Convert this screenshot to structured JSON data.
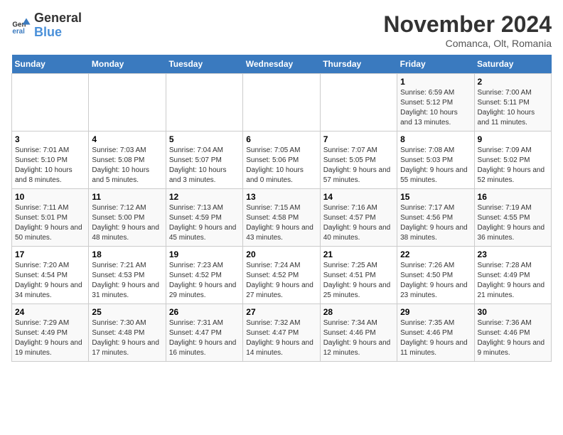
{
  "logo": {
    "line1": "General",
    "line2": "Blue"
  },
  "title": "November 2024",
  "subtitle": "Comanca, Olt, Romania",
  "days_of_week": [
    "Sunday",
    "Monday",
    "Tuesday",
    "Wednesday",
    "Thursday",
    "Friday",
    "Saturday"
  ],
  "weeks": [
    [
      {
        "day": "",
        "info": ""
      },
      {
        "day": "",
        "info": ""
      },
      {
        "day": "",
        "info": ""
      },
      {
        "day": "",
        "info": ""
      },
      {
        "day": "",
        "info": ""
      },
      {
        "day": "1",
        "info": "Sunrise: 6:59 AM\nSunset: 5:12 PM\nDaylight: 10 hours and 13 minutes."
      },
      {
        "day": "2",
        "info": "Sunrise: 7:00 AM\nSunset: 5:11 PM\nDaylight: 10 hours and 11 minutes."
      }
    ],
    [
      {
        "day": "3",
        "info": "Sunrise: 7:01 AM\nSunset: 5:10 PM\nDaylight: 10 hours and 8 minutes."
      },
      {
        "day": "4",
        "info": "Sunrise: 7:03 AM\nSunset: 5:08 PM\nDaylight: 10 hours and 5 minutes."
      },
      {
        "day": "5",
        "info": "Sunrise: 7:04 AM\nSunset: 5:07 PM\nDaylight: 10 hours and 3 minutes."
      },
      {
        "day": "6",
        "info": "Sunrise: 7:05 AM\nSunset: 5:06 PM\nDaylight: 10 hours and 0 minutes."
      },
      {
        "day": "7",
        "info": "Sunrise: 7:07 AM\nSunset: 5:05 PM\nDaylight: 9 hours and 57 minutes."
      },
      {
        "day": "8",
        "info": "Sunrise: 7:08 AM\nSunset: 5:03 PM\nDaylight: 9 hours and 55 minutes."
      },
      {
        "day": "9",
        "info": "Sunrise: 7:09 AM\nSunset: 5:02 PM\nDaylight: 9 hours and 52 minutes."
      }
    ],
    [
      {
        "day": "10",
        "info": "Sunrise: 7:11 AM\nSunset: 5:01 PM\nDaylight: 9 hours and 50 minutes."
      },
      {
        "day": "11",
        "info": "Sunrise: 7:12 AM\nSunset: 5:00 PM\nDaylight: 9 hours and 48 minutes."
      },
      {
        "day": "12",
        "info": "Sunrise: 7:13 AM\nSunset: 4:59 PM\nDaylight: 9 hours and 45 minutes."
      },
      {
        "day": "13",
        "info": "Sunrise: 7:15 AM\nSunset: 4:58 PM\nDaylight: 9 hours and 43 minutes."
      },
      {
        "day": "14",
        "info": "Sunrise: 7:16 AM\nSunset: 4:57 PM\nDaylight: 9 hours and 40 minutes."
      },
      {
        "day": "15",
        "info": "Sunrise: 7:17 AM\nSunset: 4:56 PM\nDaylight: 9 hours and 38 minutes."
      },
      {
        "day": "16",
        "info": "Sunrise: 7:19 AM\nSunset: 4:55 PM\nDaylight: 9 hours and 36 minutes."
      }
    ],
    [
      {
        "day": "17",
        "info": "Sunrise: 7:20 AM\nSunset: 4:54 PM\nDaylight: 9 hours and 34 minutes."
      },
      {
        "day": "18",
        "info": "Sunrise: 7:21 AM\nSunset: 4:53 PM\nDaylight: 9 hours and 31 minutes."
      },
      {
        "day": "19",
        "info": "Sunrise: 7:23 AM\nSunset: 4:52 PM\nDaylight: 9 hours and 29 minutes."
      },
      {
        "day": "20",
        "info": "Sunrise: 7:24 AM\nSunset: 4:52 PM\nDaylight: 9 hours and 27 minutes."
      },
      {
        "day": "21",
        "info": "Sunrise: 7:25 AM\nSunset: 4:51 PM\nDaylight: 9 hours and 25 minutes."
      },
      {
        "day": "22",
        "info": "Sunrise: 7:26 AM\nSunset: 4:50 PM\nDaylight: 9 hours and 23 minutes."
      },
      {
        "day": "23",
        "info": "Sunrise: 7:28 AM\nSunset: 4:49 PM\nDaylight: 9 hours and 21 minutes."
      }
    ],
    [
      {
        "day": "24",
        "info": "Sunrise: 7:29 AM\nSunset: 4:49 PM\nDaylight: 9 hours and 19 minutes."
      },
      {
        "day": "25",
        "info": "Sunrise: 7:30 AM\nSunset: 4:48 PM\nDaylight: 9 hours and 17 minutes."
      },
      {
        "day": "26",
        "info": "Sunrise: 7:31 AM\nSunset: 4:47 PM\nDaylight: 9 hours and 16 minutes."
      },
      {
        "day": "27",
        "info": "Sunrise: 7:32 AM\nSunset: 4:47 PM\nDaylight: 9 hours and 14 minutes."
      },
      {
        "day": "28",
        "info": "Sunrise: 7:34 AM\nSunset: 4:46 PM\nDaylight: 9 hours and 12 minutes."
      },
      {
        "day": "29",
        "info": "Sunrise: 7:35 AM\nSunset: 4:46 PM\nDaylight: 9 hours and 11 minutes."
      },
      {
        "day": "30",
        "info": "Sunrise: 7:36 AM\nSunset: 4:46 PM\nDaylight: 9 hours and 9 minutes."
      }
    ]
  ]
}
